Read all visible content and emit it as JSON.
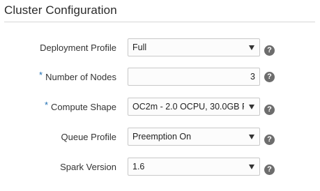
{
  "section": {
    "title": "Cluster Configuration"
  },
  "required_marker": "*",
  "help_glyph": "?",
  "fields": {
    "deployment_profile": {
      "label": "Deployment Profile",
      "value": "Full"
    },
    "number_of_nodes": {
      "label": "Number of Nodes",
      "value": "3",
      "required": true
    },
    "compute_shape": {
      "label": "Compute Shape",
      "value": "OC2m - 2.0 OCPU, 30.0GB R",
      "required": true
    },
    "queue_profile": {
      "label": "Queue Profile",
      "value": "Preemption On"
    },
    "spark_version": {
      "label": "Spark Version",
      "value": "1.6"
    }
  },
  "icons": {
    "help": "help-icon",
    "dropdown": "chevron-down-icon"
  },
  "colors": {
    "required_star": "#1f6fb3",
    "help_icon_bg": "#6d6d6d"
  }
}
